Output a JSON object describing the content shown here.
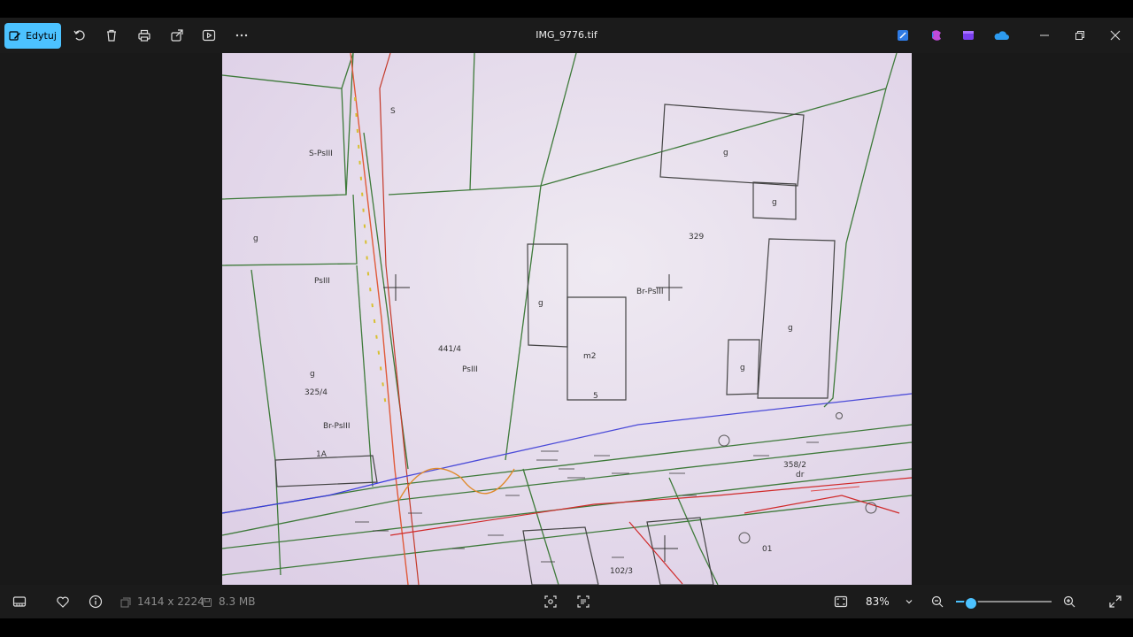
{
  "toolbar": {
    "edit_label": "Edytuj",
    "file_name": "IMG_9776.tif"
  },
  "image_labels": {
    "s": "S",
    "s_psiii": "S-PsIII",
    "g": "g",
    "psiii": "PsIII",
    "parcel_325_4": "325/4",
    "br_psiii": "Br-PsIII",
    "parcel_1a": "1A",
    "parcel_441_4": "441/4",
    "parcel_329": "329",
    "m2": "m2",
    "num5": "5",
    "parcel_358_2": "358/2",
    "dr": "dr",
    "parcel_01": "01",
    "parcel_102_3": "102/3"
  },
  "statusbar": {
    "dimensions": "1414 x 2224",
    "file_size": "8.3 MB",
    "zoom": "83%",
    "zoom_fraction": 0.16
  },
  "colors": {
    "accent": "#4cc2ff",
    "bar_bg": "#1b1b1b"
  }
}
